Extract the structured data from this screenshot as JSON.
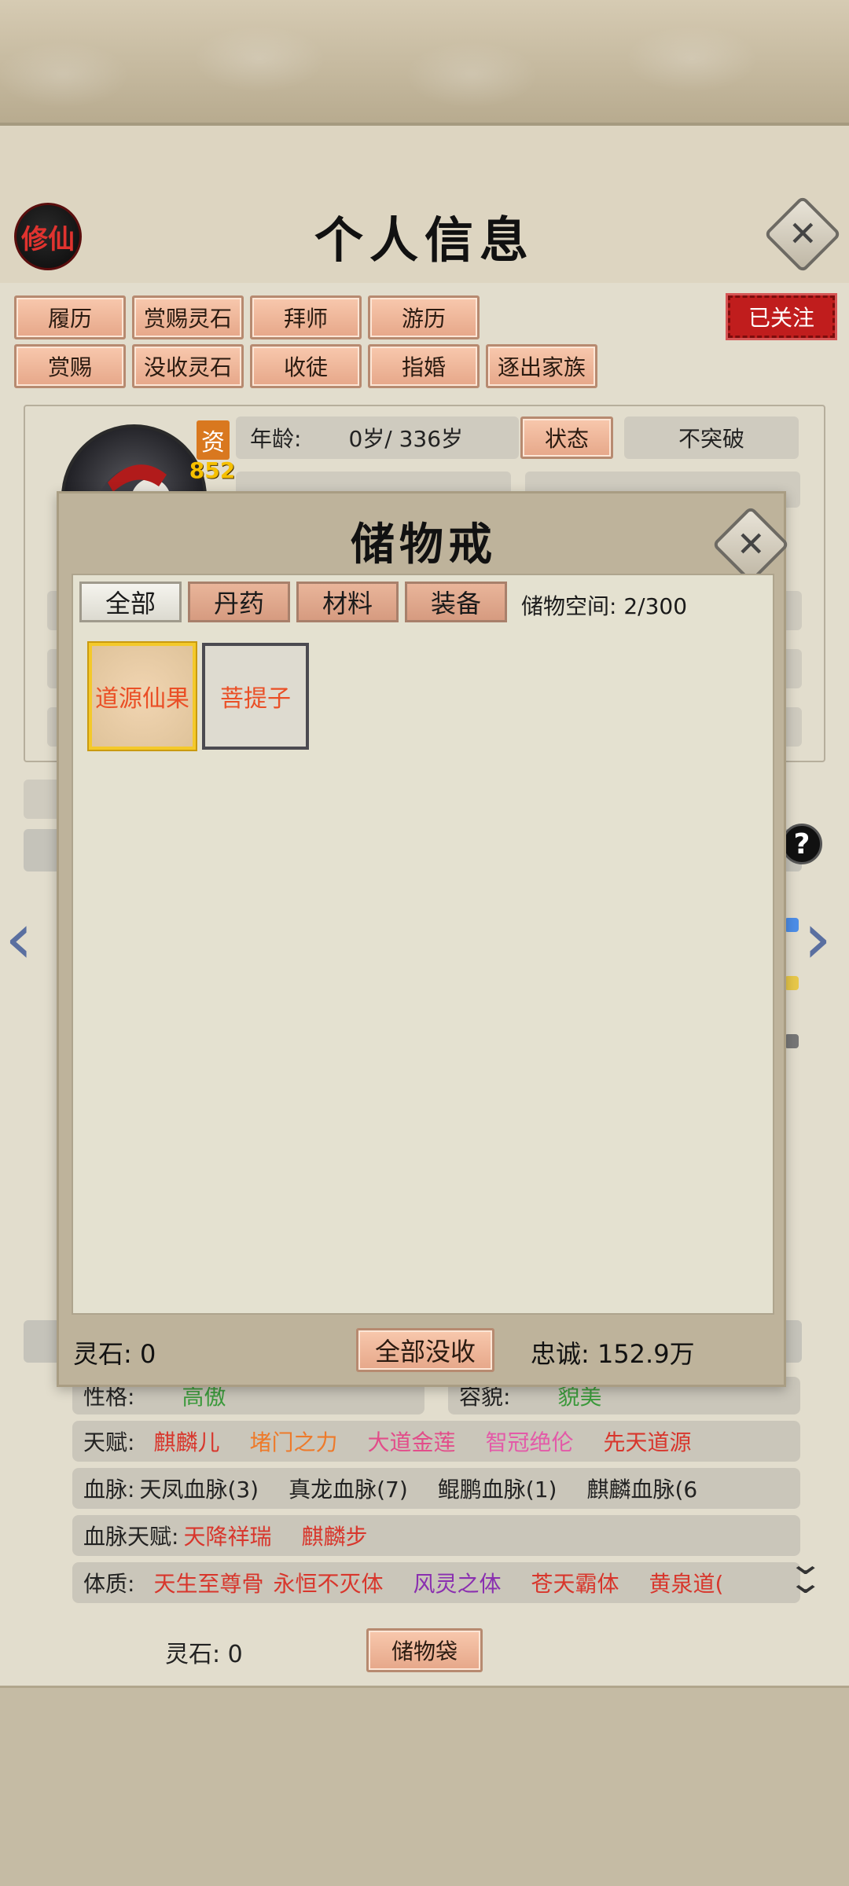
{
  "header": {
    "sect_badge": "修仙",
    "title": "个人信息",
    "close_icon": "close-icon"
  },
  "actions": {
    "row1": [
      "履历",
      "赏赐灵石",
      "拜师",
      "游历"
    ],
    "row2": [
      "赏赐",
      "没收灵石",
      "收徒",
      "指婚",
      "逐出家族"
    ],
    "followed_label": "已关注"
  },
  "profile": {
    "portrait_label": "资",
    "portrait_value": "852",
    "age_label": "年龄:",
    "age_value": "0岁/ 336岁",
    "state_button": "状态",
    "breakthrough_value": "不突破"
  },
  "attributes": {
    "personality_label": "性格:",
    "personality_value": "高傲",
    "appearance_label": "容貌:",
    "appearance_value": "貌美",
    "talent_label": "天赋:",
    "talents": [
      {
        "text": "麒麟儿",
        "color": "#d8362c"
      },
      {
        "text": "堵门之力",
        "color": "#ee7a2a"
      },
      {
        "text": "大道金莲",
        "color": "#e24d8a"
      },
      {
        "text": "智冠绝伦",
        "color": "#e35aa8"
      },
      {
        "text": "先天道源",
        "color": "#d8362c"
      }
    ],
    "bloodline_label": "血脉:",
    "bloodlines": [
      "天凤血脉(3)",
      "真龙血脉(7)",
      "鲲鹏血脉(1)",
      "麒麟血脉(6"
    ],
    "bloodline_talent_label": "血脉天赋:",
    "bloodline_talents": [
      "天降祥瑞",
      "麒麟步"
    ],
    "physique_label": "体质:",
    "physiques": [
      {
        "text": "天生至尊骨",
        "color": "#d8362c"
      },
      {
        "text": "永恒不灭体",
        "color": "#d8362c"
      },
      {
        "text": "风灵之体",
        "color": "#8a2fb0"
      },
      {
        "text": "苍天霸体",
        "color": "#d8362c"
      },
      {
        "text": "黄泉道(",
        "color": "#d8362c"
      }
    ]
  },
  "footer": {
    "stones_label": "灵石:",
    "stones_value": "0",
    "storage_bag_button": "储物袋"
  },
  "storage_modal": {
    "title": "储物戒",
    "tabs": [
      "全部",
      "丹药",
      "材料",
      "装备"
    ],
    "active_tab": "全部",
    "capacity_text": "储物空间: 2/300",
    "items": [
      "道源仙果",
      "菩提子"
    ],
    "stones_text": "灵石: 0",
    "confiscate_all_button": "全部没收",
    "loyalty_text": "忠诚: 152.9万"
  },
  "colors": {
    "accent_button": "#e6a789",
    "followed_red": "#c01d1d",
    "item_text": "#ea4f26"
  }
}
